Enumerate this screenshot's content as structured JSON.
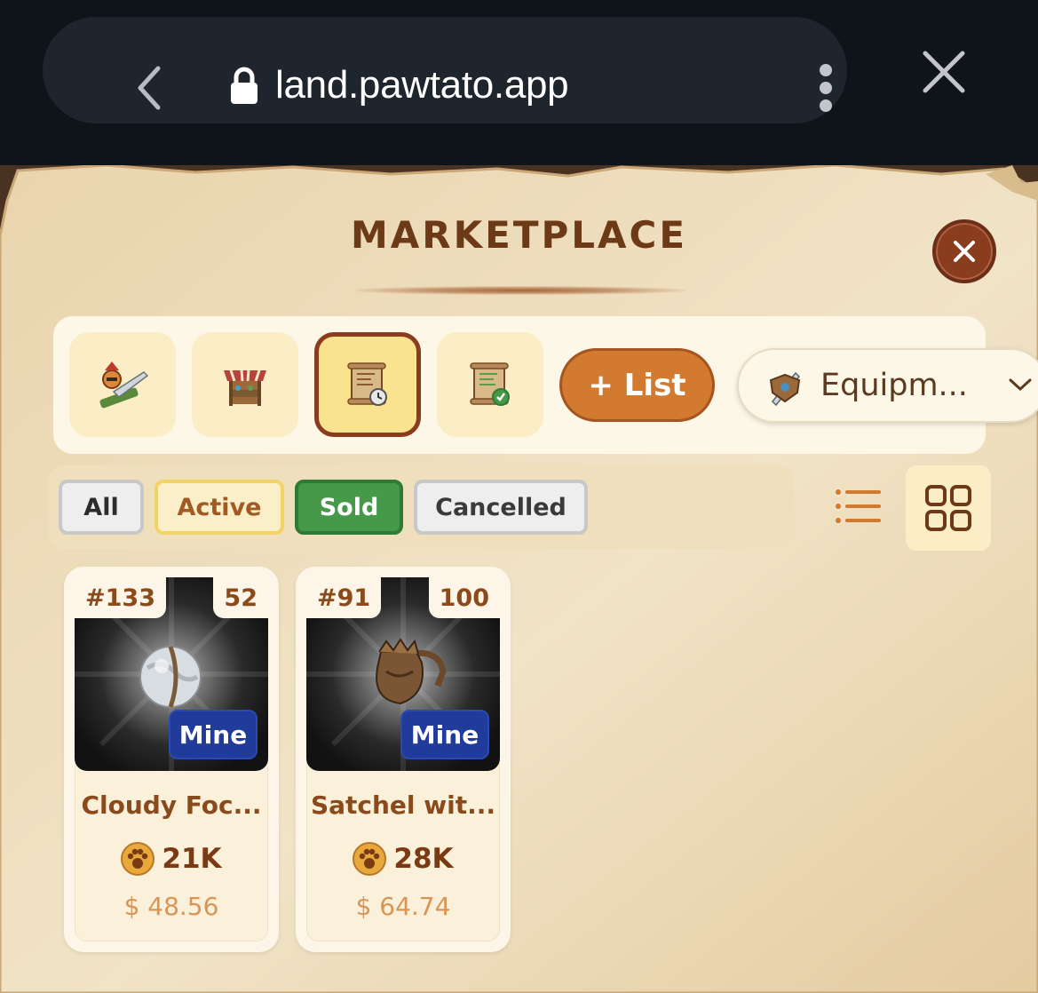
{
  "browser": {
    "url": "land.pawtato.app"
  },
  "marketplace": {
    "title": "Marketplace",
    "tabs": [
      {
        "name": "equipment-tab",
        "icon": "warrior-sword-icon"
      },
      {
        "name": "shop-tab",
        "icon": "market-stall-icon"
      },
      {
        "name": "my-listings-tab",
        "icon": "scroll-clock-icon",
        "active": true
      },
      {
        "name": "completed-tab",
        "icon": "scroll-check-icon"
      }
    ],
    "list_button": "+ List",
    "category": {
      "selected": "Equipm...",
      "icon": "sword-shield-icon"
    },
    "filters": [
      "All",
      "Active",
      "Sold",
      "Cancelled"
    ],
    "selected_filter": "Sold",
    "view_mode": "grid"
  },
  "items": [
    {
      "id": "#133",
      "count": "52",
      "tag": "Mine",
      "name": "Cloudy Foc...",
      "price": "21K",
      "usd": "$ 48.56",
      "icon": "cloudy-orb-icon"
    },
    {
      "id": "#91",
      "count": "100",
      "tag": "Mine",
      "name": "Satchel wit...",
      "price": "28K",
      "usd": "$ 64.74",
      "icon": "satchel-icon"
    }
  ],
  "colors": {
    "title": "#6d3a18",
    "accent_orange": "#d27a30",
    "sold_green": "#47994a",
    "mine_blue": "#213b9a",
    "parchment": "#efdcb8"
  }
}
